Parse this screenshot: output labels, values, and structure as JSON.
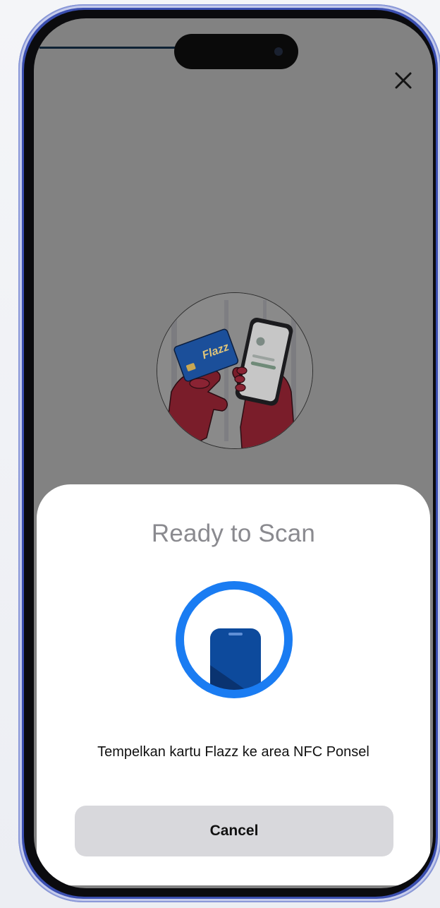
{
  "scan_sheet": {
    "title": "Ready to Scan",
    "instruction": "Tempelkan kartu Flazz ke area NFC Ponsel",
    "cancel_label": "Cancel"
  },
  "close_icon": "close-icon",
  "illustration": {
    "card_brand_text": "Flazz"
  },
  "colors": {
    "overlay": "#828282",
    "sheet_background": "#ffffff",
    "nfc_ring": "#1a7cf2",
    "nfc_phone": "#0d4a9c",
    "button_background": "#d8d8dc",
    "frame": "#3b4fb0"
  }
}
